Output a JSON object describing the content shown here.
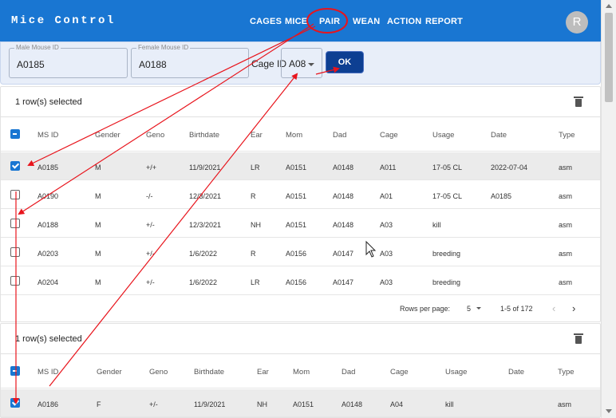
{
  "app": {
    "title": "Mice Control",
    "avatar_initial": "R",
    "accent": "#1976d2"
  },
  "nav": [
    {
      "label": "CAGES"
    },
    {
      "label": "MICE"
    },
    {
      "label": "PAIR"
    },
    {
      "label": "WEAN"
    },
    {
      "label": "ACTION"
    },
    {
      "label": "REPORT"
    }
  ],
  "pair_form": {
    "male_label": "Male Mouse ID",
    "male_value": "A0185",
    "female_label": "Female Mouse ID",
    "female_value": "A0188",
    "cage_label": "Cage ID",
    "cage_value": "A08",
    "ok_label": "OK"
  },
  "table1": {
    "selected_text": "1 row(s) selected",
    "columns": [
      "MS ID",
      "Gender",
      "Geno",
      "Birthdate",
      "Ear",
      "Mom",
      "Dad",
      "Cage",
      "Usage",
      "Date",
      "Type"
    ],
    "rows": [
      {
        "checked": true,
        "cells": [
          "A0185",
          "M",
          "+/+",
          "11/9/2021",
          "LR",
          "A0151",
          "A0148",
          "A011",
          "17-05 CL",
          "2022-07-04",
          "asm"
        ]
      },
      {
        "checked": false,
        "cells": [
          "A0190",
          "M",
          "-/-",
          "12/3/2021",
          "R",
          "A0151",
          "A0148",
          "A01",
          "17-05 CL",
          "A0185",
          "asm"
        ]
      },
      {
        "checked": false,
        "cells": [
          "A0188",
          "M",
          "+/-",
          "12/3/2021",
          "NH",
          "A0151",
          "A0148",
          "A03",
          "kill",
          "",
          "asm"
        ]
      },
      {
        "checked": false,
        "cells": [
          "A0203",
          "M",
          "+/-",
          "1/6/2022",
          "R",
          "A0156",
          "A0147",
          "A03",
          "breeding",
          "",
          "asm"
        ]
      },
      {
        "checked": false,
        "cells": [
          "A0204",
          "M",
          "+/-",
          "1/6/2022",
          "LR",
          "A0156",
          "A0147",
          "A03",
          "breeding",
          "",
          "asm"
        ]
      }
    ],
    "rows_per_page_label": "Rows per page:",
    "rows_per_page": "5",
    "range_text": "1-5 of 172",
    "prev_icon": "‹",
    "next_icon": "›"
  },
  "table2": {
    "selected_text": "1 row(s) selected",
    "columns": [
      "MS ID",
      "Gender",
      "Geno",
      "Birthdate",
      "Ear",
      "Mom",
      "Dad",
      "Cage",
      "Usage",
      "Date",
      "Type"
    ],
    "rows": [
      {
        "checked": true,
        "cells": [
          "A0186",
          "F",
          "+/-",
          "11/9/2021",
          "NH",
          "A0151",
          "A0148",
          "A04",
          "kill",
          "",
          "asm"
        ]
      }
    ]
  },
  "annotations": {
    "color": "#e8141c",
    "cursor_icon": "mouse-pointer-icon"
  }
}
